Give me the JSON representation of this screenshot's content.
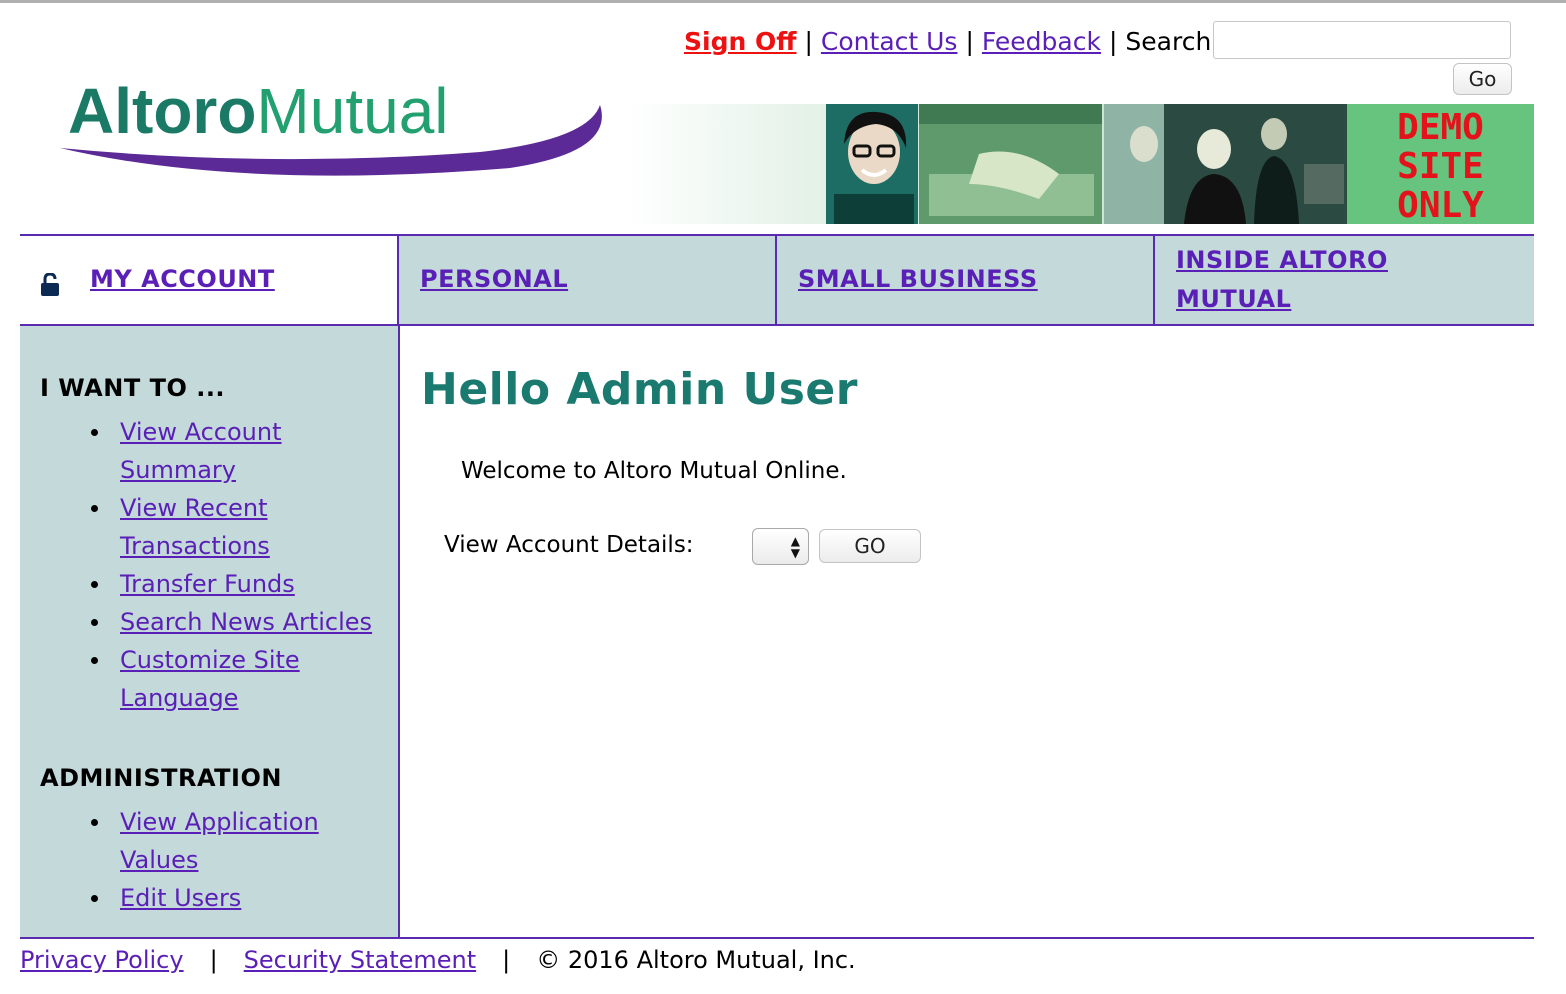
{
  "header": {
    "logo_text": "AltoroMutual",
    "signoff": "Sign Off",
    "contact": "Contact Us",
    "feedback": "Feedback",
    "sep": "|",
    "search_label": "Search",
    "search_value": "",
    "go": "Go",
    "demo_banner": [
      "DEMO",
      "SITE",
      "ONLY"
    ]
  },
  "nav": {
    "my_account": "MY ACCOUNT",
    "personal": "PERSONAL",
    "small_business": "SMALL BUSINESS",
    "inside_line1": "INSIDE ALTORO",
    "inside_line2": "MUTUAL"
  },
  "sidebar": {
    "iwant_heading": "I WANT TO ...",
    "iwant_items": [
      [
        "View Account",
        "Summary"
      ],
      [
        "View Recent",
        "Transactions"
      ],
      [
        "Transfer Funds"
      ],
      [
        "Search News Articles"
      ],
      [
        "Customize Site",
        "Language"
      ]
    ],
    "admin_heading": "ADMINISTRATION",
    "admin_items": [
      [
        "View Application",
        "Values"
      ],
      [
        "Edit Users"
      ]
    ]
  },
  "main": {
    "greeting": "Hello Admin User",
    "welcome": "Welcome to Altoro Mutual Online.",
    "view_details_label": "View Account Details:",
    "account_selected": "",
    "go_button": "GO"
  },
  "footer": {
    "privacy": "Privacy Policy",
    "security": "Security Statement",
    "sep": "|",
    "copyright": "© 2016 Altoro Mutual, Inc."
  },
  "colors": {
    "accent_purple": "#5a2bb0",
    "teal_heading": "#1a7a70",
    "nav_bg": "#c3d9da",
    "signoff_red": "#ee1111",
    "logo_green": "#1f7c67"
  }
}
